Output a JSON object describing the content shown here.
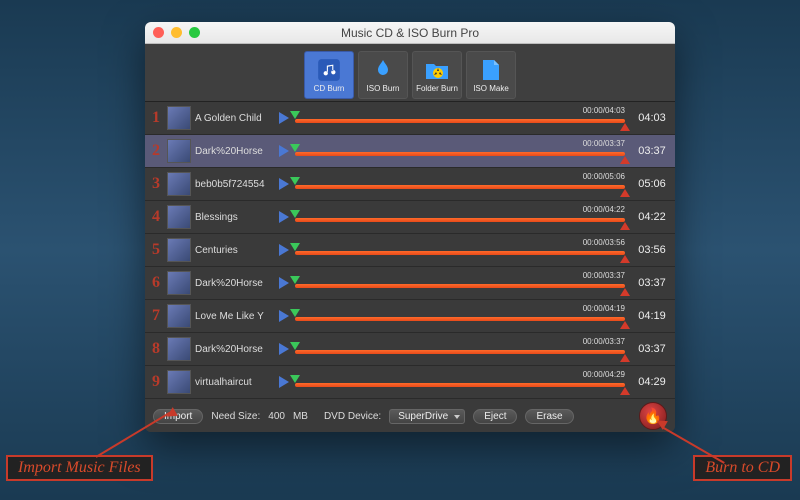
{
  "window": {
    "title": "Music CD & ISO Burn Pro"
  },
  "toolbar": {
    "items": [
      {
        "label": "CD Burn",
        "active": true,
        "icon": "music-note-icon"
      },
      {
        "label": "ISO Burn",
        "active": false,
        "icon": "flame-icon"
      },
      {
        "label": "Folder Burn",
        "active": false,
        "icon": "radiation-folder-icon"
      },
      {
        "label": "ISO Make",
        "active": false,
        "icon": "document-icon"
      }
    ]
  },
  "tracks": [
    {
      "n": "1",
      "name": "A Golden Child",
      "time": "00:00/04:03",
      "dur": "04:03",
      "sel": false
    },
    {
      "n": "2",
      "name": "Dark%20Horse",
      "time": "00:00/03:37",
      "dur": "03:37",
      "sel": true
    },
    {
      "n": "3",
      "name": "beb0b5f724554",
      "time": "00:00/05:06",
      "dur": "05:06",
      "sel": false
    },
    {
      "n": "4",
      "name": "Blessings",
      "time": "00:00/04:22",
      "dur": "04:22",
      "sel": false
    },
    {
      "n": "5",
      "name": "Centuries",
      "time": "00:00/03:56",
      "dur": "03:56",
      "sel": false
    },
    {
      "n": "6",
      "name": "Dark%20Horse",
      "time": "00:00/03:37",
      "dur": "03:37",
      "sel": false
    },
    {
      "n": "7",
      "name": "Love Me Like Y",
      "time": "00:00/04:19",
      "dur": "04:19",
      "sel": false
    },
    {
      "n": "8",
      "name": "Dark%20Horse",
      "time": "00:00/03:37",
      "dur": "03:37",
      "sel": false
    },
    {
      "n": "9",
      "name": "virtualhaircut",
      "time": "00:00/04:29",
      "dur": "04:29",
      "sel": false
    }
  ],
  "footer": {
    "import_label": "Import",
    "need_size_label": "Need Size:",
    "need_size_value": "400",
    "need_size_unit": "MB",
    "dvd_device_label": "DVD Device:",
    "dvd_device_value": "SuperDrive",
    "eject_label": "Eject",
    "erase_label": "Erase"
  },
  "callouts": {
    "import": "Import Music Files",
    "burn": "Burn to CD"
  }
}
